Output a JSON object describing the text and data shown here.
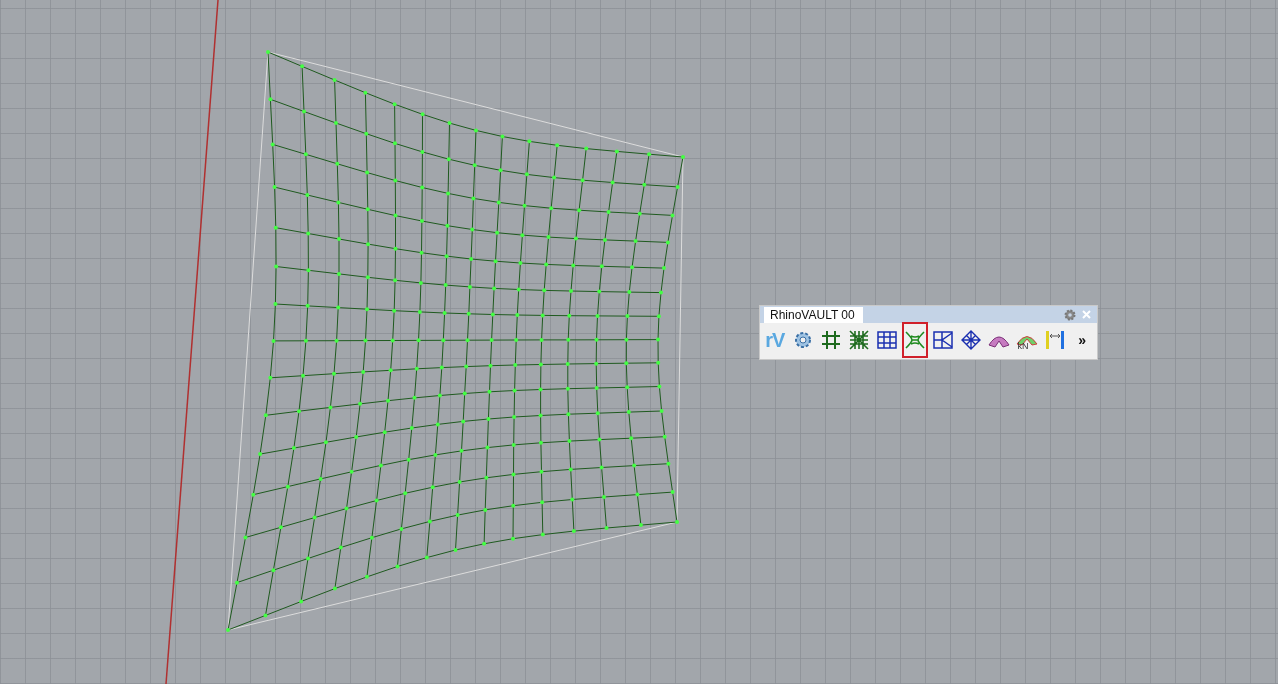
{
  "toolbar": {
    "title": "RhinoVAULT 00",
    "tools": [
      {
        "kind": "logo",
        "label": "rV",
        "selected": false
      },
      {
        "kind": "gears",
        "selected": false
      },
      {
        "kind": "grid-square",
        "selected": false
      },
      {
        "kind": "grid-star",
        "selected": false
      },
      {
        "kind": "grid-blue",
        "selected": false
      },
      {
        "kind": "web",
        "selected": true
      },
      {
        "kind": "split-box",
        "selected": false
      },
      {
        "kind": "diamond",
        "selected": false
      },
      {
        "kind": "vault",
        "selected": false
      },
      {
        "kind": "force",
        "label": "kN",
        "selected": false
      },
      {
        "kind": "dimension",
        "selected": false
      },
      {
        "kind": "more",
        "label": "»",
        "selected": false
      }
    ]
  }
}
